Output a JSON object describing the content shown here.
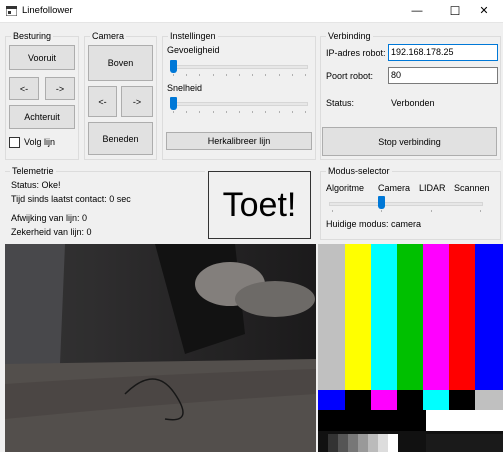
{
  "window": {
    "title": "Linefollower",
    "controls": {
      "minimize": "—",
      "maximize": "☐",
      "close": "✕"
    }
  },
  "besturing": {
    "label": "Besturing",
    "forward": "Vooruit",
    "left": "<-",
    "right": "->",
    "backward": "Achteruit",
    "follow_line": "Volg lijn"
  },
  "camera": {
    "label": "Camera",
    "up": "Boven",
    "left": "<-",
    "right": "->",
    "down": "Beneden"
  },
  "instellingen": {
    "label": "Instellingen",
    "sensitivity": "Gevoeligheid",
    "speed": "Snelheid",
    "recalibrate": "Herkalibreer lijn",
    "sensitivity_level": 0,
    "speed_level": 0
  },
  "verbinding": {
    "label": "Verbinding",
    "ip_label": "IP-adres robot:",
    "ip_value": "192.168.178.25",
    "port_label": "Poort robot:",
    "port_value": "80",
    "status_label": "Status:",
    "status_value": "Verbonden",
    "stop_button": "Stop verbinding"
  },
  "telemetrie": {
    "label": "Telemetrie",
    "status": "Status: Oke!",
    "last_contact": "Tijd sinds laatst contact: 0 sec",
    "deviation": "Afwijking van lijn: 0",
    "certainty": "Zekerheid van lijn: 0"
  },
  "toet_button": "Toet!",
  "modus": {
    "label": "Modus-selector",
    "options": [
      "Algoritme",
      "Camera",
      "LIDAR",
      "Scannen"
    ],
    "selected_index": 1,
    "current": "Huidige modus: camera"
  },
  "colors": {
    "accent": "#0078d7",
    "button_face": "#e1e1e1",
    "window_bg": "#f0f0f0"
  }
}
